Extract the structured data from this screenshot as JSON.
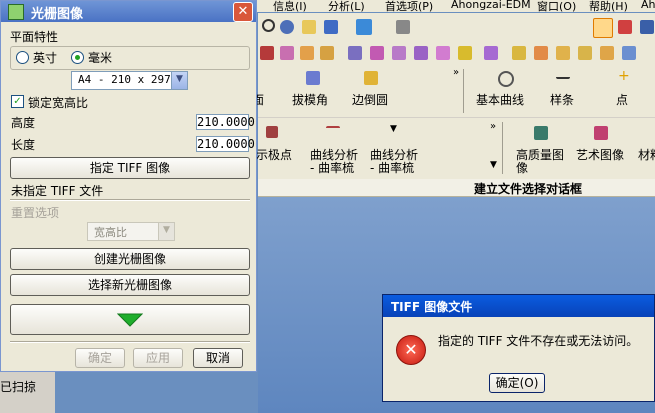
{
  "app": {
    "menu": [
      "信息(I)",
      "分析(L)",
      "首选项(P)",
      "Ahongzai-EDM",
      "窗口(O)",
      "帮助(H)",
      "Ah"
    ],
    "ribbon": {
      "row1": [
        "面",
        "拔模角",
        "边倒圆",
        "基本曲线",
        "样条",
        "点"
      ],
      "row2": [
        "示极点",
        "曲线分析",
        "- 曲率梳",
        "曲线分析",
        "- 曲率梳",
        "高质量图",
        "像",
        "艺术图像",
        "材料"
      ]
    },
    "status_text": "建立文件选择对话框",
    "left_status": "已扫掠"
  },
  "dialog": {
    "title": "光栅图像",
    "section_label": "平面特性",
    "unit_options": [
      "英寸",
      "毫米"
    ],
    "unit_selected": "毫米",
    "paper_size": "A4 - 210 x 297",
    "lock_aspect_label": "锁定宽高比",
    "lock_aspect_checked": true,
    "height_label": "高度",
    "height_value": "210.0000",
    "length_label": "长度",
    "length_value": "210.0000",
    "specify_tiff_button": "指定 TIFF 图像",
    "tiff_status": "未指定 TIFF 文件",
    "reset_options_label": "重置选项",
    "aspect_select": "宽高比",
    "create_button": "创建光栅图像",
    "select_new_button": "选择新光栅图像",
    "ok_button": "确定",
    "apply_button": "应用",
    "cancel_button": "取消"
  },
  "message_box": {
    "title": "TIFF 图像文件",
    "message": "指定的 TIFF 文件不存在或无法访问。",
    "ok_button": "确定(O)"
  },
  "colors": {
    "dialog_title": "#4a72c4",
    "msg_title": "#0842b8",
    "error_icon": "#d8231b",
    "green_arrow": "#1fae2c"
  }
}
